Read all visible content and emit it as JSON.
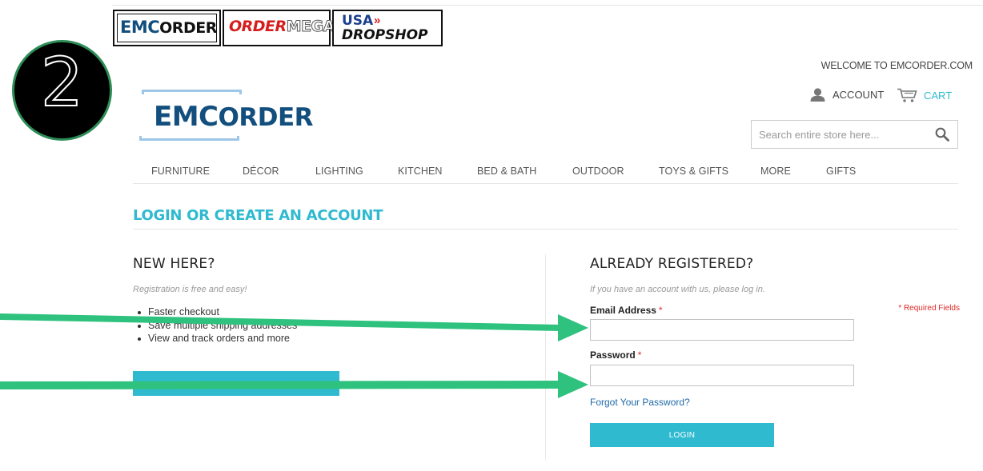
{
  "badges": {
    "emc": {
      "part1": "EMC",
      "part2": "ORDER"
    },
    "ordermega": {
      "part1": "ORDER",
      "part2": "MEGA"
    },
    "usa": {
      "line1": "USA",
      "arrow": "»",
      "line2": "DROPSHOP"
    }
  },
  "step": {
    "number": "2"
  },
  "header": {
    "welcome": "WELCOME TO EMCORDER.COM",
    "account_label": "ACCOUNT",
    "cart_label": "CART",
    "logo_part1": "EMC",
    "logo_part2": "ORDER",
    "search_placeholder": "Search entire store here..."
  },
  "nav": {
    "items": [
      {
        "label": "FURNITURE"
      },
      {
        "label": "DÉCOR"
      },
      {
        "label": "LIGHTING"
      },
      {
        "label": "KITCHEN"
      },
      {
        "label": "BED & BATH"
      },
      {
        "label": "OUTDOOR"
      },
      {
        "label": "TOYS & GIFTS"
      },
      {
        "label": "MORE"
      },
      {
        "label": "GIFTS"
      }
    ]
  },
  "page": {
    "title": "LOGIN OR CREATE AN ACCOUNT"
  },
  "new_customer": {
    "title": "NEW HERE?",
    "subtitle": "Registration is free and easy!",
    "benefits": [
      "Faster checkout",
      "Save multiple shipping addresses",
      "View and track orders and more"
    ]
  },
  "login": {
    "title": "ALREADY REGISTERED?",
    "subtitle": "If you have an account with us, please log in.",
    "required_note": "* Required Fields",
    "email_label": "Email Address",
    "password_label": "Password",
    "required_star": "*",
    "forgot_link": "Forgot Your Password?",
    "login_button": "LOGIN"
  },
  "colors": {
    "accent": "#2fbad0",
    "annotation_arrow": "#2ec27e",
    "required": "#e02b27",
    "brand_blue": "#134f7e"
  },
  "icons": {
    "account": "person-icon",
    "cart": "cart-icon",
    "search": "magnifier-icon"
  }
}
